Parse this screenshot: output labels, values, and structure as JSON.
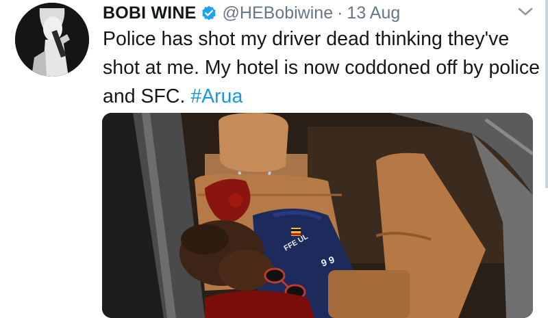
{
  "tweet": {
    "display_name": "BOBI WINE",
    "handle": "@HEBobiwine",
    "separator": "·",
    "date": "13 Aug",
    "text": "Police has shot my driver dead thinking they've shot at me. My hotel is now coddoned off by police and SFC.",
    "hashtag": "#Arua"
  },
  "media": {
    "jersey_text": "FFE UL",
    "jersey_number": "9 9"
  },
  "icons": {
    "verified": "verified-badge-icon",
    "caret": "chevron-down-icon"
  },
  "colors": {
    "hashtag": "#1b95e0",
    "verified": "#1da1f2",
    "secondary_text": "#657786"
  }
}
